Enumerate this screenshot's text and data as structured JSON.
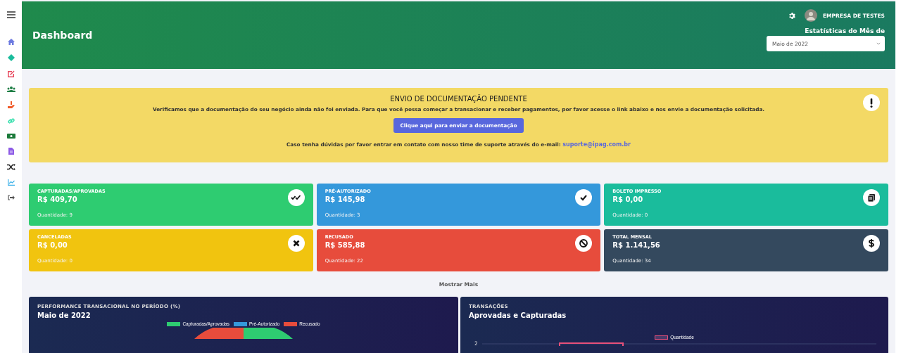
{
  "sidebar": {
    "items": [
      {
        "kind": "home",
        "color": "#6c7ae0"
      },
      {
        "kind": "diamond",
        "color": "#1abc9c"
      },
      {
        "kind": "edit",
        "color": "#e84a5f"
      },
      {
        "kind": "users",
        "color": "#1e7e45"
      },
      {
        "kind": "hand",
        "color": "#f05a28"
      },
      {
        "kind": "link",
        "color": "#3ee0b0"
      },
      {
        "kind": "money",
        "color": "#1b7a3a"
      },
      {
        "kind": "file",
        "color": "#8e5ce6"
      },
      {
        "kind": "shuffle",
        "color": "#222222"
      },
      {
        "kind": "chart",
        "color": "#3ab0e8"
      },
      {
        "kind": "logout",
        "color": "#555555"
      }
    ]
  },
  "header": {
    "title": "Dashboard",
    "company": "EMPRESA DE TESTES",
    "stats_label": "Estatísticas do Mês de",
    "month_select": "Maio de 2022"
  },
  "alert": {
    "title": "ENVIO DE DOCUMENTAÇÃO PENDENTE",
    "message": "Verificamos que a documentação do seu negócio ainda não foi enviada. Para que você possa começar a transacionar e receber pagamentos, por favor acesse o link abaixo e nos envie a documentação solicitada.",
    "button": "Clique aqui para enviar a documentação",
    "contact": "Caso tenha dúvidas por favor entrar em contato com nosso time de suporte através do e-mail:",
    "email": "suporte@ipag.com.br"
  },
  "cards": [
    {
      "label": "CAPTURADAS/APROVADAS",
      "amount": "R$ 409,70",
      "count": "Quantidade: 9",
      "kind": "double-check",
      "color": "#2ecc71"
    },
    {
      "label": "PRÉ-AUTORIZADO",
      "amount": "R$ 145,98",
      "count": "Quantidade: 3",
      "kind": "check",
      "color": "#3498db"
    },
    {
      "label": "BOLETO IMPRESSO",
      "amount": "R$ 0,00",
      "count": "Quantidade: 0",
      "kind": "receipt",
      "color": "#1abc9c"
    },
    {
      "label": "CANCELADAS",
      "amount": "R$ 0,00",
      "count": "Quantidade: 0",
      "kind": "times",
      "color": "#f1c40f"
    },
    {
      "label": "RECUSADO",
      "amount": "R$ 585,88",
      "count": "Quantidade: 22",
      "kind": "ban",
      "color": "#e74c3c"
    },
    {
      "label": "TOTAL MENSAL",
      "amount": "R$ 1.141,56",
      "count": "Quantidade: 34",
      "kind": "dollar",
      "color": "#34495e"
    }
  ],
  "show_more": "Mostrar Mais",
  "panels": [
    {
      "kind": "pie",
      "subtitle": "PERFORMANCE TRANSACIONAL NO PERÍODO (%)",
      "title": "Maio de 2022",
      "legend": [
        {
          "label": "Capturadas/Aprovadas",
          "color": "#2ecc71"
        },
        {
          "label": "Pré-Autorizado",
          "color": "#3498db"
        },
        {
          "label": "Recusado",
          "color": "#e74c3c"
        }
      ]
    },
    {
      "kind": "line",
      "subtitle": "TRANSAÇÕES",
      "title": "Aprovadas e Capturadas",
      "legend": [
        {
          "label": "Quantidade",
          "color": "#e8507a"
        }
      ],
      "tick": "2"
    }
  ]
}
